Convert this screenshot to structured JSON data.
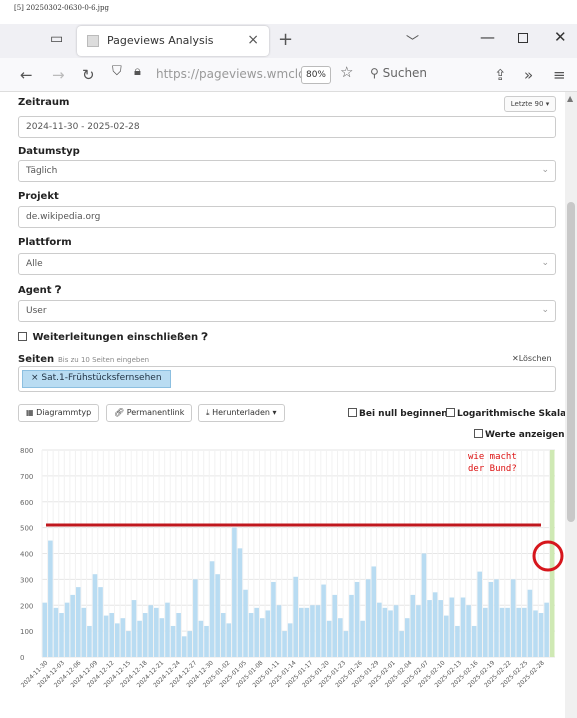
{
  "screenshot_label": "[5] 20250302-0630-0-6.jpg",
  "browser": {
    "tab_title": "Pageviews Analysis",
    "url": "https://pageviews.wmcloud.org",
    "url_host": "https://pageviews.wmclo",
    "zoom": "80%",
    "search_placeholder": "Suchen"
  },
  "form": {
    "zeitraum_label": "Zeitraum",
    "zeitraum_value": "2024-11-30 - 2025-02-28",
    "zeitraum_button": "Letzte 90 ▾",
    "datumstyp_label": "Datumstyp",
    "datumstyp_value": "Täglich",
    "projekt_label": "Projekt",
    "projekt_value": "de.wikipedia.org",
    "plattform_label": "Plattform",
    "plattform_value": "Alle",
    "agent_label": "Agent",
    "agent_value": "User",
    "redirects_label": "Weiterleitungen einschließen",
    "seiten_label": "Seiten",
    "seiten_hint": "Bis zu 10 Seiten eingeben",
    "clear_label": "Löschen",
    "page_tag": "Sat.1-Frühstücksfernsehen"
  },
  "toolbar": {
    "chart_type": "Diagrammtyp",
    "permalink": "Permanentlink",
    "download": "Herunterladen",
    "begin_zero": "Bei null beginnen",
    "log_scale": "Logarithmische Skala",
    "show_values": "Werte anzeigen"
  },
  "annotation": "wie macht\nder Bund?",
  "colors": {
    "bar": "#b9dcf2",
    "bar_last": "#cfe9b4",
    "reference_line": "#c0181e",
    "circle": "#d6161c",
    "grid": "#e6e6e6"
  },
  "chart_data": {
    "type": "bar",
    "ylim": [
      0,
      800
    ],
    "yticks": [
      0,
      100,
      200,
      300,
      400,
      500,
      600,
      700,
      800
    ],
    "reference_line_value": 510,
    "x_labels": [
      "2024-11-30",
      "2024-12-03",
      "2024-12-06",
      "2024-12-09",
      "2024-12-12",
      "2024-12-15",
      "2024-12-18",
      "2024-12-21",
      "2024-12-24",
      "2024-12-27",
      "2024-12-30",
      "2025-01-02",
      "2025-01-05",
      "2025-01-08",
      "2025-01-11",
      "2025-01-14",
      "2025-01-17",
      "2025-01-20",
      "2025-01-23",
      "2025-01-26",
      "2025-01-29",
      "2025-02-01",
      "2025-02-04",
      "2025-02-07",
      "2025-02-10",
      "2025-02-13",
      "2025-02-16",
      "2025-02-19",
      "2025-02-22",
      "2025-02-25",
      "2025-02-28"
    ],
    "values": [
      210,
      450,
      190,
      170,
      210,
      240,
      270,
      190,
      120,
      320,
      270,
      160,
      170,
      130,
      150,
      100,
      220,
      140,
      170,
      200,
      190,
      150,
      210,
      120,
      170,
      80,
      100,
      300,
      140,
      120,
      370,
      320,
      170,
      130,
      500,
      420,
      260,
      170,
      190,
      150,
      180,
      290,
      200,
      100,
      130,
      310,
      190,
      190,
      200,
      200,
      280,
      140,
      240,
      150,
      100,
      240,
      290,
      140,
      300,
      350,
      210,
      190,
      180,
      200,
      100,
      150,
      240,
      200,
      400,
      220,
      250,
      220,
      160,
      230,
      120,
      230,
      200,
      120,
      330,
      190,
      290,
      300,
      190,
      190,
      300,
      190,
      190,
      260,
      180,
      170,
      210,
      820
    ]
  }
}
